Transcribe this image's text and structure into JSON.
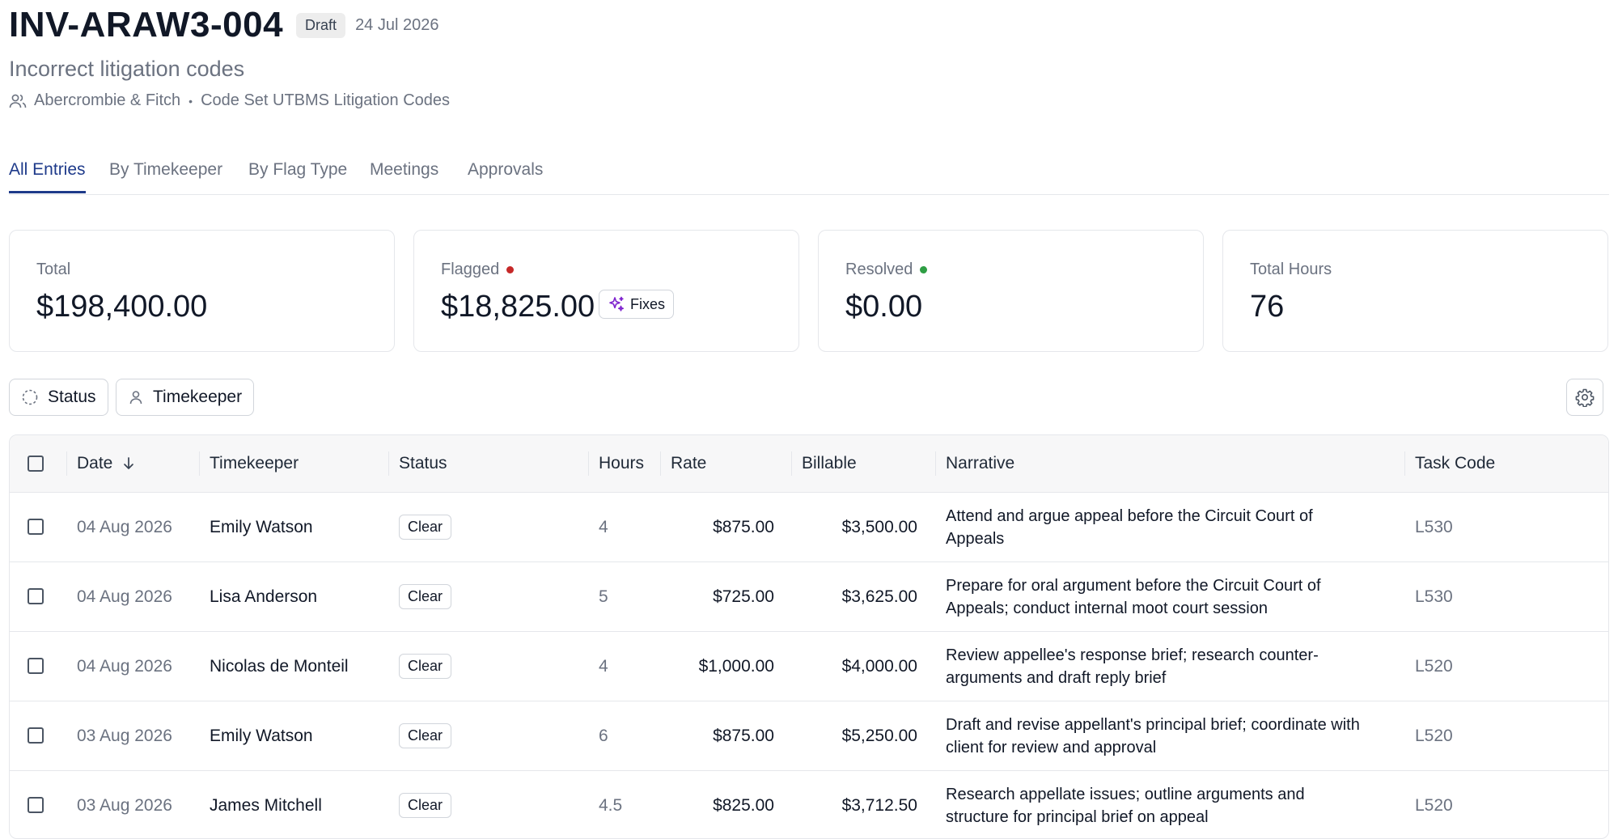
{
  "invoice": {
    "id": "INV-ARAW3-004",
    "status_badge": "Draft",
    "date": "24 Jul 2026",
    "subtitle": "Incorrect litigation codes",
    "client": "Abercrombie & Fitch",
    "separator": "•",
    "code_set": "Code Set UTBMS Litigation Codes"
  },
  "tabs": [
    {
      "label": "All Entries",
      "active": true
    },
    {
      "label": "By Timekeeper",
      "active": false
    },
    {
      "label": "By Flag Type",
      "active": false
    },
    {
      "label": "Meetings",
      "active": false
    },
    {
      "label": "Approvals",
      "active": false
    }
  ],
  "cards": {
    "total": {
      "label": "Total",
      "value": "$198,400.00"
    },
    "flagged": {
      "label": "Flagged",
      "value": "$18,825.00",
      "fixes_label": "Fixes",
      "dot_color": "#c62828"
    },
    "resolved": {
      "label": "Resolved",
      "value": "$0.00",
      "dot_color": "#2e9e44"
    },
    "hours": {
      "label": "Total Hours",
      "value": "76"
    }
  },
  "filters": {
    "status": "Status",
    "timekeeper": "Timekeeper"
  },
  "table": {
    "headers": {
      "date": "Date",
      "timekeeper": "Timekeeper",
      "status": "Status",
      "hours": "Hours",
      "rate": "Rate",
      "billable": "Billable",
      "narrative": "Narrative",
      "task_code": "Task Code"
    },
    "rows": [
      {
        "date": "04 Aug 2026",
        "timekeeper": "Emily Watson",
        "status": "Clear",
        "hours": "4",
        "rate": "$875.00",
        "billable": "$3,500.00",
        "narrative": "Attend and argue appeal before the Circuit Court of Appeals",
        "task_code": "L530"
      },
      {
        "date": "04 Aug 2026",
        "timekeeper": "Lisa Anderson",
        "status": "Clear",
        "hours": "5",
        "rate": "$725.00",
        "billable": "$3,625.00",
        "narrative": "Prepare for oral argument before the Circuit Court of Appeals; conduct internal moot court session",
        "task_code": "L530"
      },
      {
        "date": "04 Aug 2026",
        "timekeeper": "Nicolas de Monteil",
        "status": "Clear",
        "hours": "4",
        "rate": "$1,000.00",
        "billable": "$4,000.00",
        "narrative": "Review appellee's response brief; research counter-arguments and draft reply brief",
        "task_code": "L520"
      },
      {
        "date": "03 Aug 2026",
        "timekeeper": "Emily Watson",
        "status": "Clear",
        "hours": "6",
        "rate": "$875.00",
        "billable": "$5,250.00",
        "narrative": "Draft and revise appellant's principal brief; coordinate with client for review and approval",
        "task_code": "L520"
      },
      {
        "date": "03 Aug 2026",
        "timekeeper": "James Mitchell",
        "status": "Clear",
        "hours": "4.5",
        "rate": "$825.00",
        "billable": "$3,712.50",
        "narrative": "Research appellate issues; outline arguments and structure for principal brief on appeal",
        "task_code": "L520"
      }
    ]
  }
}
